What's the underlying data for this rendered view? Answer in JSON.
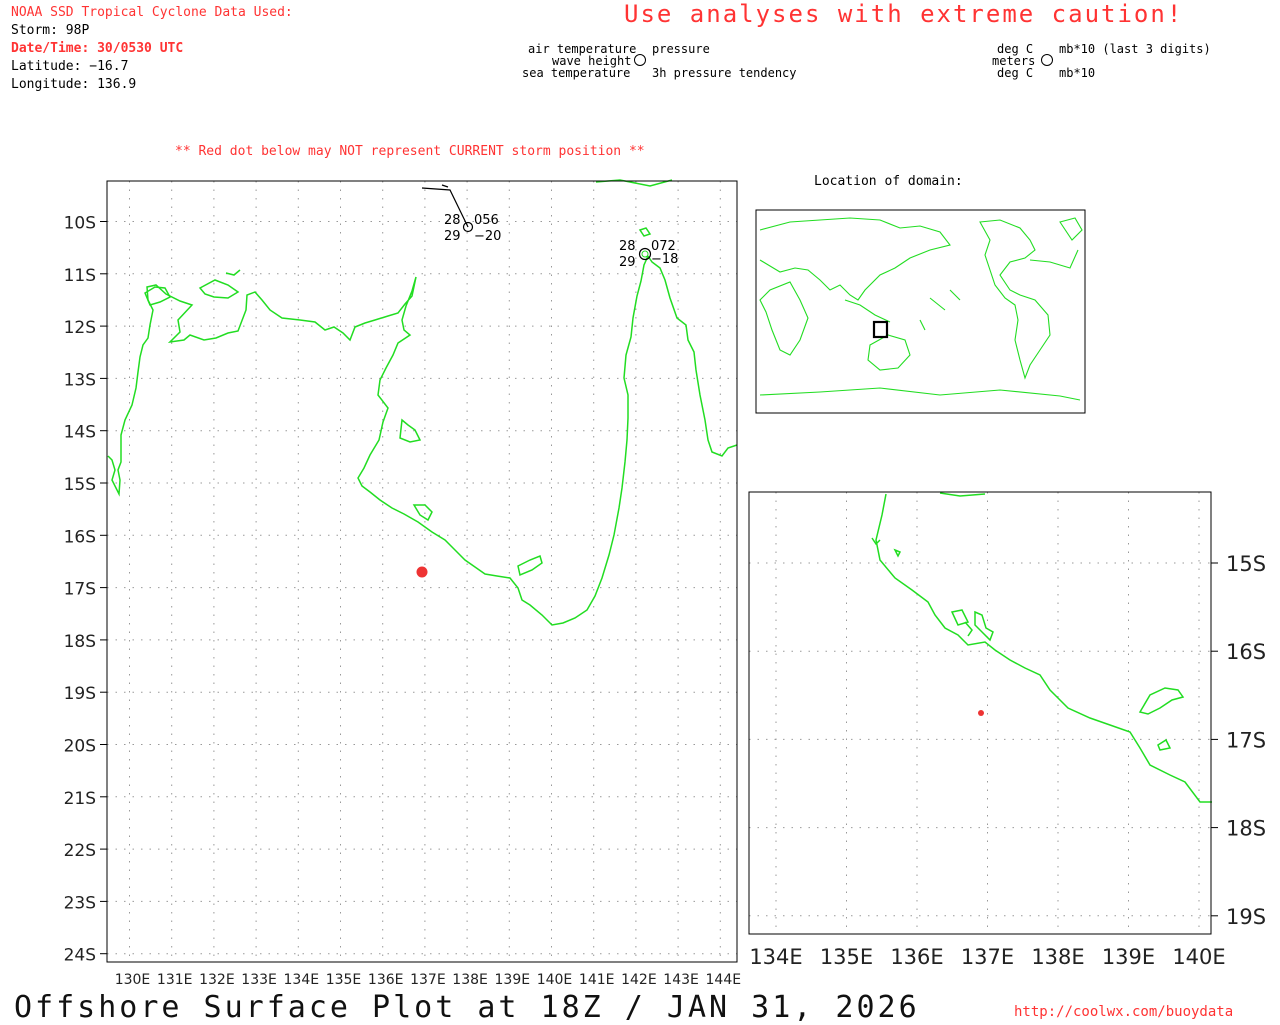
{
  "header": {
    "source": "NOAA SSD Tropical Cyclone Data Used:",
    "storm": "Storm: 98P",
    "datetime": "Date/Time: 30/0530 UTC",
    "latitude": "Latitude: −16.7",
    "longitude": "Longitude: 136.9",
    "caution": "Use analyses with extreme caution!"
  },
  "legend_left": {
    "air_temp": "air temperature",
    "pressure": "pressure",
    "wave_height": "wave height",
    "sea_temp": "sea temperature",
    "tendency": "3h pressure tendency"
  },
  "legend_right": {
    "air_unit": "deg C",
    "pressure_unit": "mb*10 (last 3 digits)",
    "wave_unit": "meters",
    "sea_unit": "deg C",
    "tendency_unit": "mb*10"
  },
  "notice": "** Red dot below may NOT represent CURRENT storm position **",
  "inset_title": "Location of domain:",
  "footer": {
    "title": "Offshore Surface Plot at 18Z / JAN 31, 2026",
    "url": "http://coolwx.com/buoydata"
  },
  "colors": {
    "coast": "#22dd22",
    "storm_dot": "#ee3333",
    "text_red": "#ff3333"
  },
  "main_map": {
    "lat_labels": [
      "10S",
      "11S",
      "12S",
      "13S",
      "14S",
      "15S",
      "16S",
      "17S",
      "18S",
      "19S",
      "20S",
      "21S",
      "22S",
      "23S",
      "24S"
    ],
    "lon_labels": [
      "130E",
      "131E",
      "132E",
      "133E",
      "134E",
      "135E",
      "136E",
      "137E",
      "138E",
      "139E",
      "140E",
      "141E",
      "142E",
      "143E",
      "144E"
    ]
  },
  "zoom_map": {
    "lat_labels": [
      "15S",
      "16S",
      "17S",
      "18S",
      "19S"
    ],
    "lon_labels": [
      "134E",
      "135E",
      "136E",
      "137E",
      "138E",
      "139E",
      "140E"
    ]
  },
  "observations": [
    {
      "air": "28",
      "pressure": "056",
      "sea": "29",
      "tendency": "−20"
    },
    {
      "air": "28",
      "pressure": "072",
      "sea": "29",
      "tendency": "−18"
    }
  ]
}
